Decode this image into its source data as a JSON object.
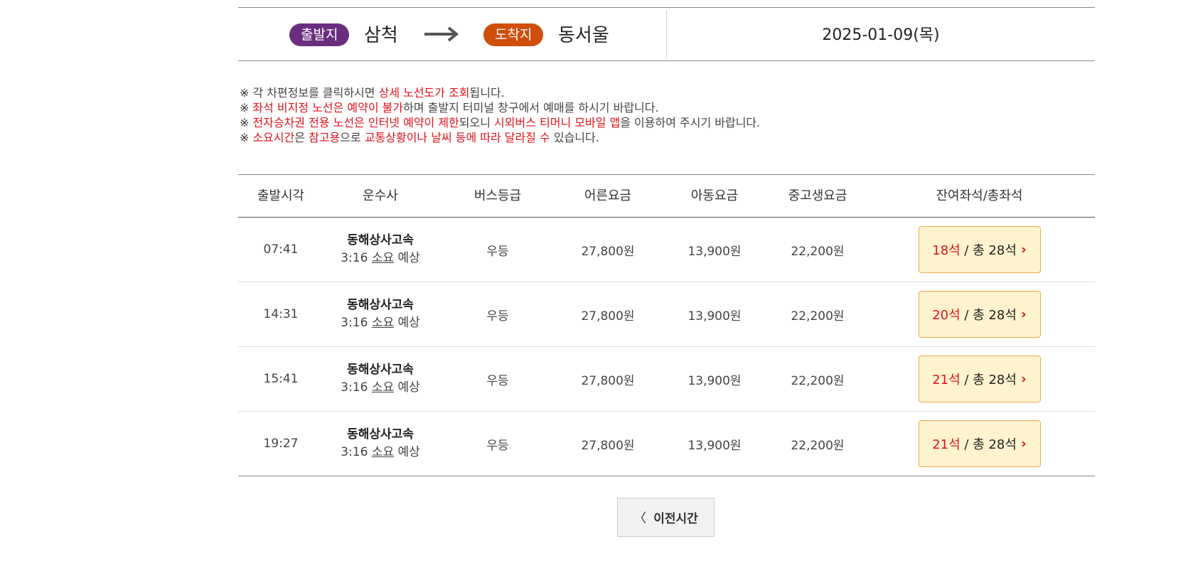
{
  "route": {
    "depart_label": "출발지",
    "depart_city": "삼척",
    "arrive_label": "도착지",
    "arrive_city": "동서울",
    "date": "2025-01-09(목)"
  },
  "notices": [
    [
      {
        "t": "※",
        "s": "mark"
      },
      {
        "t": "각 차편정보를 클릭하시면 "
      },
      {
        "t": "상세 노선도가 조회",
        "s": "red"
      },
      {
        "t": "됩니다."
      }
    ],
    [
      {
        "t": "※",
        "s": "mark"
      },
      {
        "t": "좌석 비지정 노선은 예약이 불가",
        "s": "red"
      },
      {
        "t": "하며 출발지 터미널 창구에서 예매를 하시기 바랍니다."
      }
    ],
    [
      {
        "t": "※",
        "s": "mark"
      },
      {
        "t": "전자승차권 전용 노선은 인터넷 예약이 제한",
        "s": "red"
      },
      {
        "t": "되오니 "
      },
      {
        "t": "시외버스 티머니 모바일 앱",
        "s": "red"
      },
      {
        "t": "을 이용하여 주시기 바랍니다."
      }
    ],
    [
      {
        "t": "※",
        "s": "mark"
      },
      {
        "t": "소요시간",
        "s": "red"
      },
      {
        "t": "은 "
      },
      {
        "t": "참고용",
        "s": "red"
      },
      {
        "t": "으로 "
      },
      {
        "t": "교통상황이나 날씨 등에 따라 달라질 수",
        "s": "red"
      },
      {
        "t": " 있습니다."
      }
    ]
  ],
  "table": {
    "headers": [
      "출발시각",
      "운수사",
      "버스등급",
      "어른요금",
      "아동요금",
      "중고생요금",
      "잔여좌석/총좌석"
    ],
    "rows": [
      {
        "time": "07:41",
        "operator": "동해상사고속",
        "duration": "3:16",
        "duration_mid": "소요",
        "duration_end": "예상",
        "grade": "우등",
        "adult": "27,800원",
        "child": "13,900원",
        "youth": "22,200원",
        "remaining": "18석",
        "total": "/ 총 28석"
      },
      {
        "time": "14:31",
        "operator": "동해상사고속",
        "duration": "3:16",
        "duration_mid": "소요",
        "duration_end": "예상",
        "grade": "우등",
        "adult": "27,800원",
        "child": "13,900원",
        "youth": "22,200원",
        "remaining": "20석",
        "total": "/ 총 28석"
      },
      {
        "time": "15:41",
        "operator": "동해상사고속",
        "duration": "3:16",
        "duration_mid": "소요",
        "duration_end": "예상",
        "grade": "우등",
        "adult": "27,800원",
        "child": "13,900원",
        "youth": "22,200원",
        "remaining": "21석",
        "total": "/ 총 28석"
      },
      {
        "time": "19:27",
        "operator": "동해상사고속",
        "duration": "3:16",
        "duration_mid": "소요",
        "duration_end": "예상",
        "grade": "우등",
        "adult": "27,800원",
        "child": "13,900원",
        "youth": "22,200원",
        "remaining": "21석",
        "total": "/ 총 28석"
      }
    ]
  },
  "prev_button": {
    "label": "이전시간",
    "icon": "chevron-left-icon"
  },
  "colors": {
    "depart_pill": "#6b2e7f",
    "arrive_pill": "#cf4e0c",
    "highlight": "#e0121b",
    "seat_bg": "#fff3cf",
    "seat_border": "#f2a548"
  }
}
